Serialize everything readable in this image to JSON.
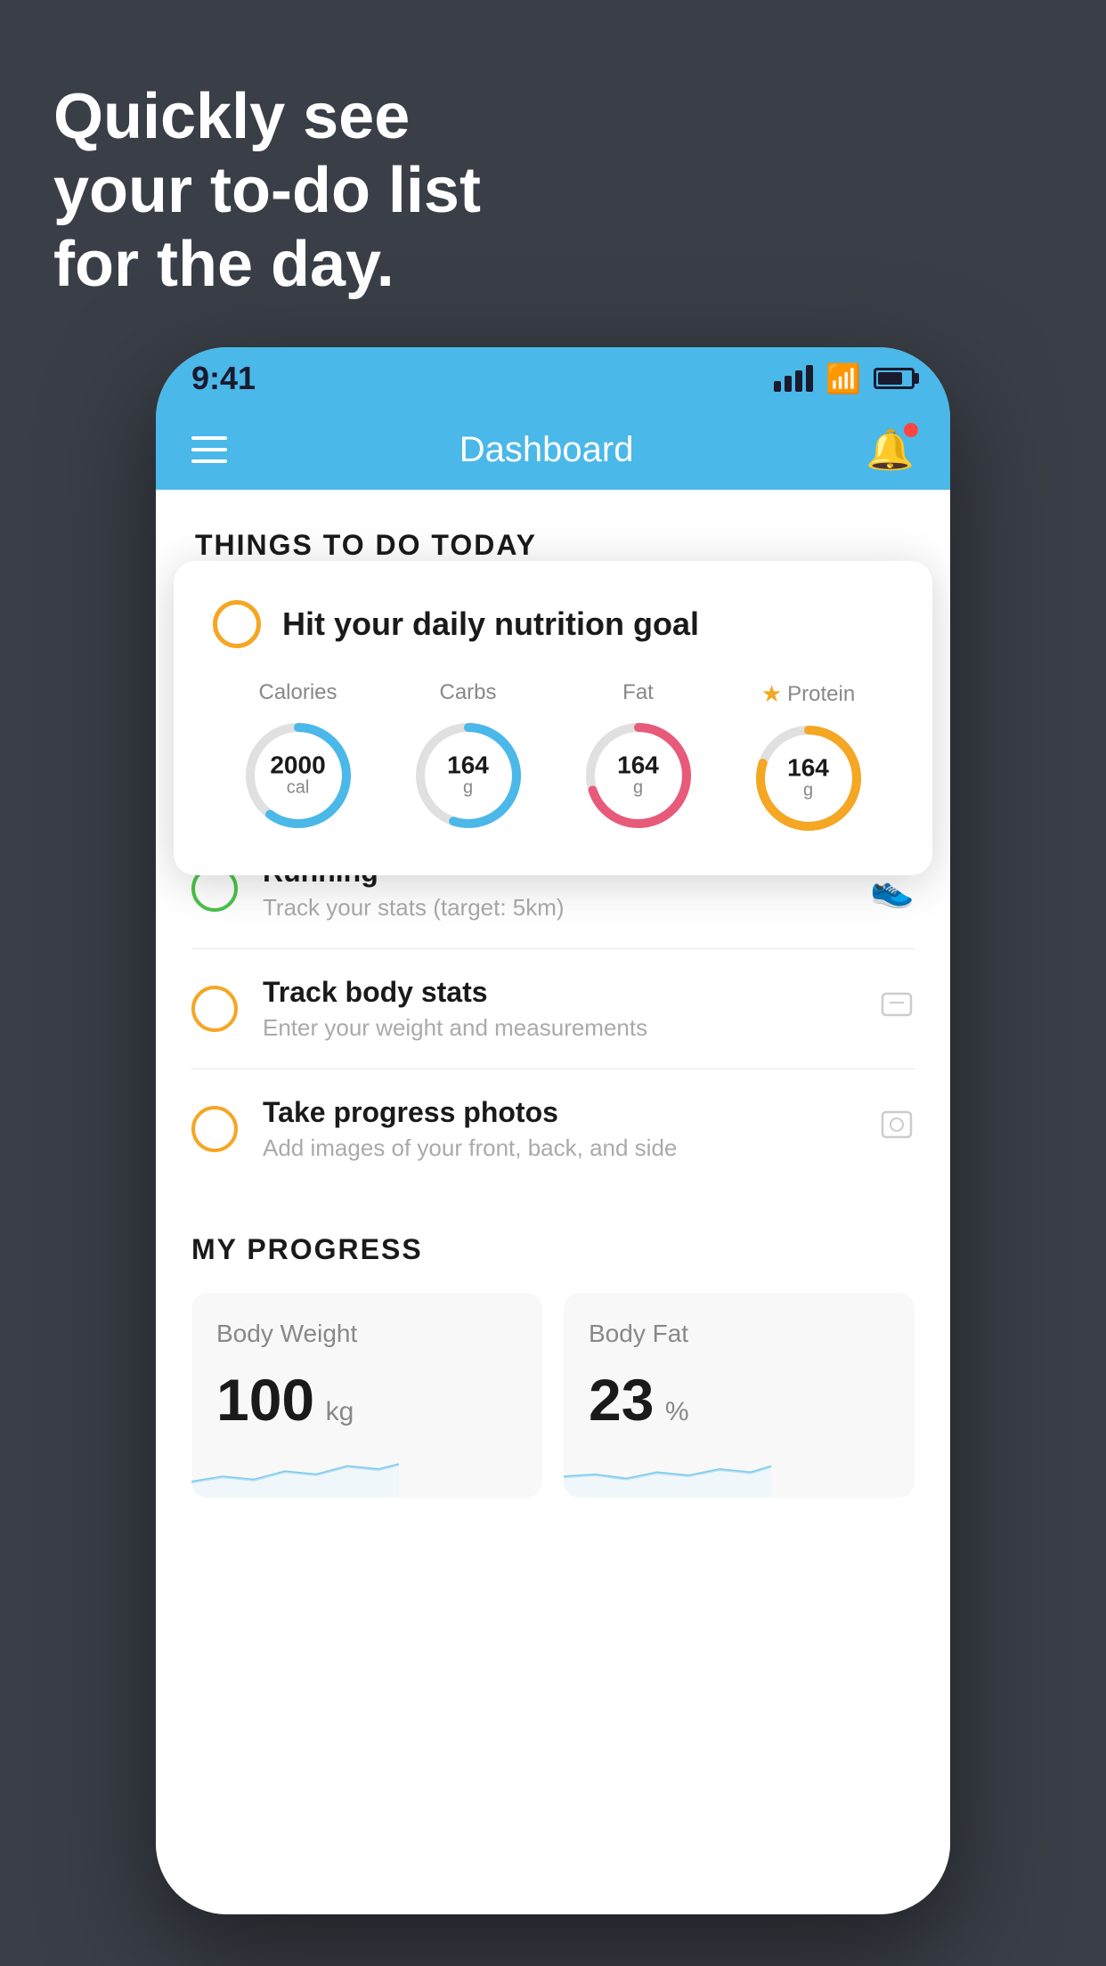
{
  "headline": {
    "line1": "Quickly see",
    "line2": "your to-do list",
    "line3": "for the day."
  },
  "status_bar": {
    "time": "9:41"
  },
  "nav": {
    "title": "Dashboard"
  },
  "things_header": "THINGS TO DO TODAY",
  "nutrition_card": {
    "title": "Hit your daily nutrition goal",
    "stats": [
      {
        "label": "Calories",
        "value": "2000",
        "unit": "cal",
        "color": "#4ab8e8",
        "percent": 60
      },
      {
        "label": "Carbs",
        "value": "164",
        "unit": "g",
        "color": "#4ab8e8",
        "percent": 55
      },
      {
        "label": "Fat",
        "value": "164",
        "unit": "g",
        "color": "#e85a7a",
        "percent": 70
      },
      {
        "label": "Protein",
        "value": "164",
        "unit": "g",
        "color": "#f5a623",
        "percent": 80,
        "star": true
      }
    ]
  },
  "todo_items": [
    {
      "title": "Running",
      "subtitle": "Track your stats (target: 5km)",
      "circle": "green",
      "icon": "shoe"
    },
    {
      "title": "Track body stats",
      "subtitle": "Enter your weight and measurements",
      "circle": "yellow",
      "icon": "scale"
    },
    {
      "title": "Take progress photos",
      "subtitle": "Add images of your front, back, and side",
      "circle": "yellow",
      "icon": "person"
    }
  ],
  "progress_section": {
    "header": "MY PROGRESS",
    "cards": [
      {
        "title": "Body Weight",
        "value": "100",
        "unit": "kg"
      },
      {
        "title": "Body Fat",
        "value": "23",
        "unit": "%"
      }
    ]
  }
}
